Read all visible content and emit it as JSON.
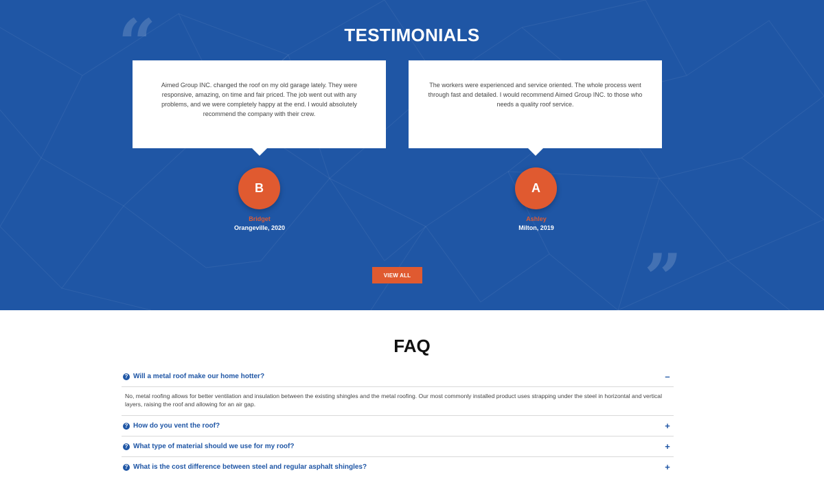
{
  "testimonials": {
    "title": "TESTIMONIALS",
    "quote_open": "“",
    "quote_close": "”",
    "items": [
      {
        "text": "Aimed Group INC. changed the roof on my old garage lately. They were responsive, amazing, on time and fair priced. The job went out with any problems, and we were completely happy at the end. I would absolutely recommend the company with their crew.",
        "initial": "B",
        "name": "Bridget",
        "meta": "Orangeville, 2020"
      },
      {
        "text": "The workers were experienced and service oriented. The whole process went through fast and detailed. I would recommend Aimed Group INC. to those who needs a quality roof service.",
        "initial": "A",
        "name": "Ashley",
        "meta": "Milton, 2019"
      }
    ],
    "view_all_label": "VIEW ALL"
  },
  "faq": {
    "title": "FAQ",
    "question_icon": "?",
    "items": [
      {
        "question": "Will a metal roof make our home hotter?",
        "toggle": "–",
        "answer": "No, metal roofing allows for better ventilation and insulation between the existing shingles and the metal roofing. Our most commonly installed product uses strapping under the steel in horizontal and vertical layers, raising the roof and allowing for an air gap."
      },
      {
        "question": "How do you vent the roof?",
        "toggle": "+"
      },
      {
        "question": "What type of material should we use for my roof?",
        "toggle": "+"
      },
      {
        "question": "What is the cost difference between steel and regular asphalt shingles?",
        "toggle": "+"
      }
    ]
  },
  "colors": {
    "brand_blue": "#1f56a5",
    "accent_orange": "#e05a30"
  }
}
